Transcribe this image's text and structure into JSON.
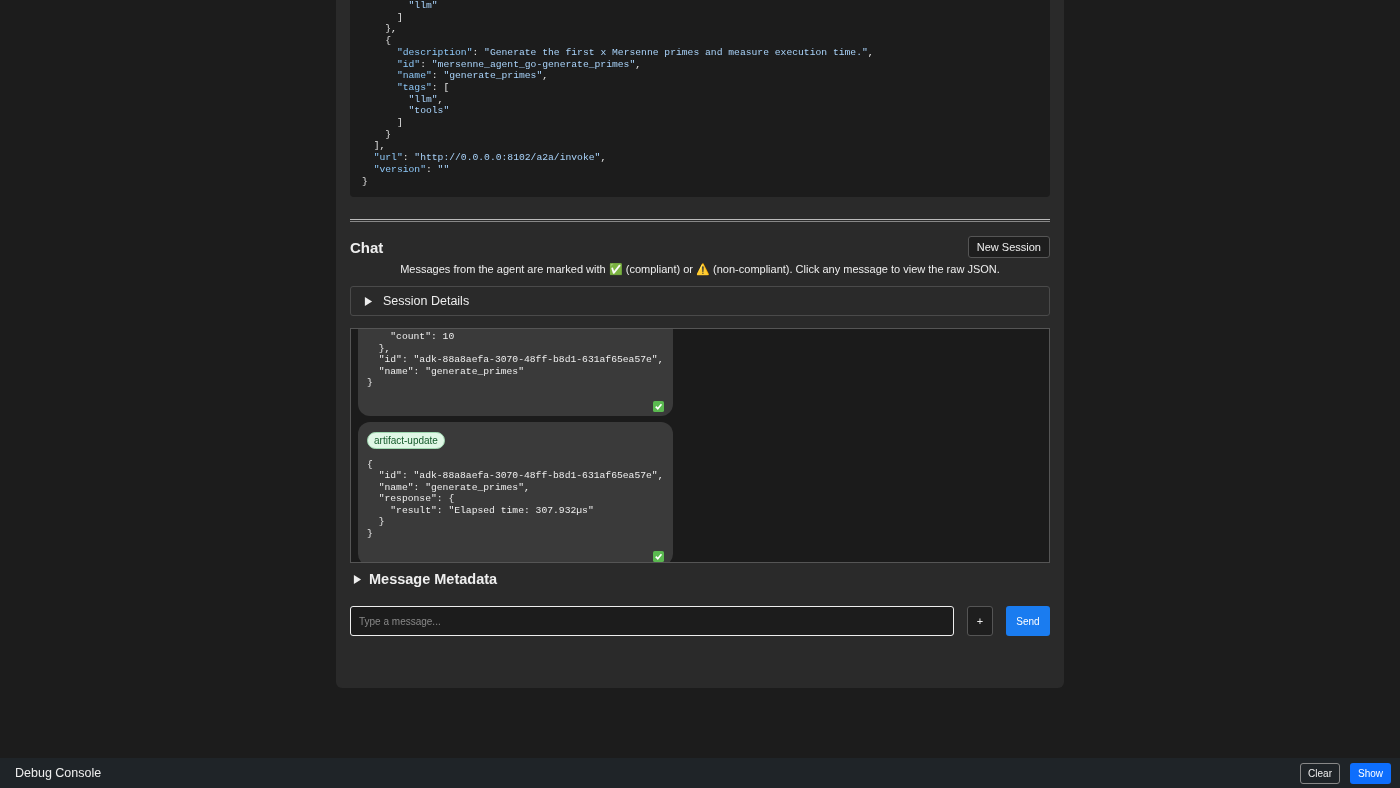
{
  "agent_card": {
    "lines": [
      [
        {
          "kind": "string",
          "text": "        \"llm\""
        }
      ],
      [
        {
          "kind": "punct",
          "text": "      ]"
        }
      ],
      [
        {
          "kind": "punct",
          "text": "    },"
        }
      ],
      [
        {
          "kind": "punct",
          "text": "    {"
        }
      ],
      [
        {
          "kind": "key",
          "text": "      \"description\""
        },
        {
          "kind": "punct",
          "text": ": "
        },
        {
          "kind": "string",
          "text": "\"Generate the first x Mersenne primes and measure execution time.\""
        },
        {
          "kind": "punct",
          "text": ","
        }
      ],
      [
        {
          "kind": "key",
          "text": "      \"id\""
        },
        {
          "kind": "punct",
          "text": ": "
        },
        {
          "kind": "string",
          "text": "\"mersenne_agent_go-generate_primes\""
        },
        {
          "kind": "punct",
          "text": ","
        }
      ],
      [
        {
          "kind": "key",
          "text": "      \"name\""
        },
        {
          "kind": "punct",
          "text": ": "
        },
        {
          "kind": "string",
          "text": "\"generate_primes\""
        },
        {
          "kind": "punct",
          "text": ","
        }
      ],
      [
        {
          "kind": "key",
          "text": "      \"tags\""
        },
        {
          "kind": "punct",
          "text": ": ["
        }
      ],
      [
        {
          "kind": "string",
          "text": "        \"llm\""
        },
        {
          "kind": "punct",
          "text": ","
        }
      ],
      [
        {
          "kind": "string",
          "text": "        \"tools\""
        }
      ],
      [
        {
          "kind": "punct",
          "text": "      ]"
        }
      ],
      [
        {
          "kind": "punct",
          "text": "    }"
        }
      ],
      [
        {
          "kind": "punct",
          "text": "  ],"
        }
      ],
      [
        {
          "kind": "key",
          "text": "  \"url\""
        },
        {
          "kind": "punct",
          "text": ": "
        },
        {
          "kind": "string",
          "text": "\"http://0.0.0.0:8102/a2a/invoke\""
        },
        {
          "kind": "punct",
          "text": ","
        }
      ],
      [
        {
          "kind": "key",
          "text": "  \"version\""
        },
        {
          "kind": "punct",
          "text": ": "
        },
        {
          "kind": "string",
          "text": "\"\""
        }
      ],
      [
        {
          "kind": "punct",
          "text": "}"
        }
      ]
    ]
  },
  "chat": {
    "title": "Chat",
    "new_session_button": "New Session",
    "notice": "Messages from the agent are marked with ✅ (compliant) or ⚠️ (non-compliant). Click any message to view the raw JSON.",
    "session_details": {
      "label": "Session Details",
      "expanded": false
    },
    "messages": [
      {
        "compliant": true,
        "lines": [
          "    \"count\": 10",
          "  },",
          "  \"id\": \"adk-88a8aefa-3070-48ff-b8d1-631af65ea57e\",",
          "  \"name\": \"generate_primes\"",
          "}"
        ]
      },
      {
        "tag": "artifact-update",
        "compliant": true,
        "lines": [
          "{",
          "  \"id\": \"adk-88a8aefa-3070-48ff-b8d1-631af65ea57e\",",
          "  \"name\": \"generate_primes\",",
          "  \"response\": {",
          "    \"result\": \"Elapsed time: 307.932µs\"",
          "  }",
          "}"
        ]
      }
    ],
    "message_metadata": {
      "label": "Message Metadata",
      "expanded": false
    },
    "input": {
      "placeholder": "Type a message..."
    },
    "attach_button": "+",
    "send_button": "Send"
  },
  "debug_console": {
    "title": "Debug Console",
    "clear_button": "Clear",
    "show_button": "Show"
  }
}
